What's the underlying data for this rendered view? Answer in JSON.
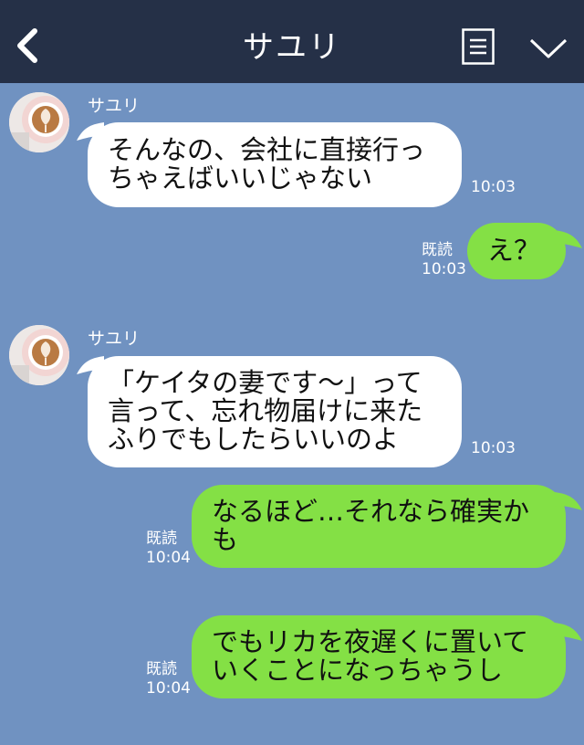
{
  "header": {
    "title": "サユリ",
    "back_icon": "chevron-left-icon",
    "menu_icon": "note-icon",
    "collapse_icon": "chevron-down-icon",
    "bg_color": "#253047"
  },
  "chat": {
    "bg_color": "#7092c1",
    "messages": [
      {
        "sender": "サユリ",
        "lines": [
          "そんなの、会社に直接行っ",
          "ちゃえばいいじゃない"
        ],
        "time": "10:03"
      },
      {
        "lines": [
          "え？"
        ],
        "read": "既読",
        "time": "10:03"
      },
      {
        "sender": "サユリ",
        "lines": [
          "「ケイタの妻です〜」って",
          "言って、忘れ物届けに来た",
          "ふりでもしたらいいのよ"
        ],
        "time": "10:03"
      },
      {
        "lines": [
          "なるほど…それなら確実か",
          "も"
        ],
        "read": "既読",
        "time": "10:04"
      },
      {
        "lines": [
          "でもリカを夜遅くに置いて",
          "いくことになっちゃうし"
        ],
        "read": "既読",
        "time": "10:04"
      }
    ]
  }
}
